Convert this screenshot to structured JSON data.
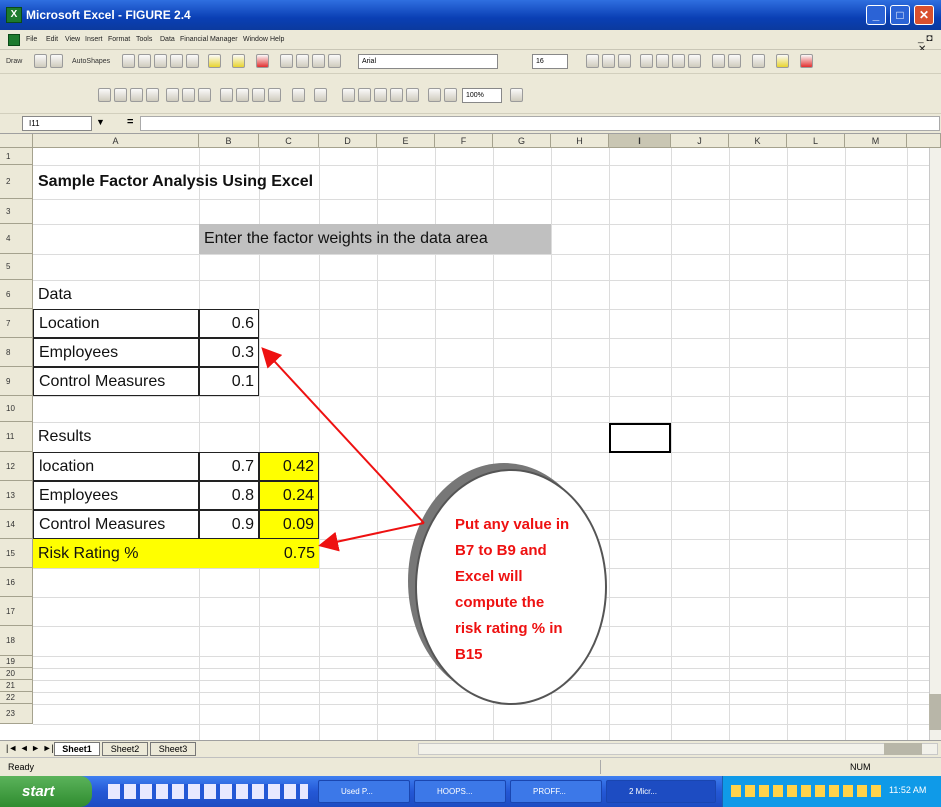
{
  "window": {
    "title": "Microsoft Excel - FIGURE 2.4",
    "min": "_",
    "max": "□",
    "close": "✕"
  },
  "menu": [
    "File",
    "Edit",
    "View",
    "Insert",
    "Format",
    "Tools",
    "Data",
    "Financial Manager",
    "Window",
    "Help"
  ],
  "drawbar": {
    "draw": "Draw",
    "autoshapes": "AutoShapes",
    "font": "Arial",
    "size": "16",
    "zoom": "100%"
  },
  "formula": {
    "namebox": "I11",
    "eq": "="
  },
  "columns": [
    "A",
    "B",
    "C",
    "D",
    "E",
    "F",
    "G",
    "H",
    "I",
    "J",
    "K",
    "L",
    "M"
  ],
  "rows": [
    "1",
    "2",
    "3",
    "4",
    "5",
    "6",
    "7",
    "8",
    "9",
    "10",
    "11",
    "12",
    "13",
    "14",
    "15",
    "16",
    "17",
    "18",
    "19",
    "20",
    "21",
    "22",
    "23"
  ],
  "sheet": {
    "title": "Sample Factor Analysis Using Excel",
    "instruction": "Enter the factor weights in the data area",
    "data_label": "Data",
    "data": [
      {
        "name": "Location",
        "weight": "0.6"
      },
      {
        "name": "Employees",
        "weight": "0.3"
      },
      {
        "name": "Control Measures",
        "weight": "0.1"
      }
    ],
    "results_label": "Results",
    "results": [
      {
        "name": "location",
        "score": "0.7",
        "product": "0.42"
      },
      {
        "name": "Employees",
        "score": "0.8",
        "product": "0.24"
      },
      {
        "name": "Control Measures",
        "score": "0.9",
        "product": "0.09"
      }
    ],
    "risk_label": "Risk Rating %",
    "risk_value": "0.75"
  },
  "callout": {
    "lines": [
      "Put any value in",
      "B7 to B9 and",
      "Excel will",
      "compute the",
      "risk rating % in",
      "B15"
    ],
    "color": "#ee1111"
  },
  "tabs": [
    "Sheet1",
    "Sheet2",
    "Sheet3"
  ],
  "status": {
    "ready": "Ready",
    "num": "NUM"
  },
  "taskbar": {
    "start": "start",
    "tasks": [
      "Used P...",
      "HOOPS...",
      "PROFF...",
      "2 Micr..."
    ],
    "time": "11:52 AM"
  }
}
